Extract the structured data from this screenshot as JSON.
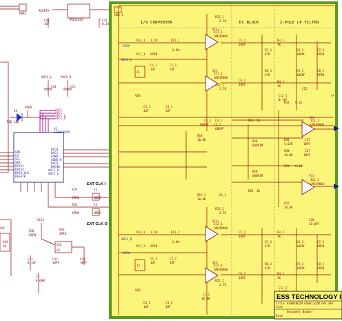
{
  "title_block": {
    "company": "ESS TECHNOLOGY I",
    "lines": [
      "Title",
      "ES9038Q2M ES9311Q2M DAC REF",
      "Size",
      "Document Number",
      "Date"
    ]
  },
  "sections": {
    "iv": "I/V CONVERTER",
    "dc": "DC BLOCK",
    "lpf": "2-POLE LP FILTER"
  },
  "clock_labels": {
    "ext_clk_1": "EXT CLK I",
    "ext_clk_2": "EXT CLK O"
  },
  "power_labels": {
    "avcc_l": "AVCC_L",
    "avcc_r": "AVCC_R",
    "avdd": "AVDD",
    "dvdd": "DVDD",
    "vcca": "VCCA",
    "vcc": "VCC",
    "reset": "RESET#"
  },
  "components": {
    "dac": "U1",
    "dac_part": "ES9038Q2M",
    "reg_top": "TM23LV33",
    "osc": "U2",
    "led": "D1",
    "led_part": "RED LED",
    "opamp_part": "LME49860",
    "opamps": [
      "IC1_1",
      "IC1_2",
      "IC2_1",
      "IC2_2",
      "IC3_1",
      "IC3_2",
      "IC4_1",
      "IC4_2",
      "IC5_1",
      "IC5_2"
    ],
    "resistors": [
      "R11",
      "R12",
      "R13",
      "R14",
      "R15",
      "R16",
      "R17",
      "R18",
      "R19",
      "R20",
      "R21",
      "R22",
      "R23",
      "R24",
      "R25",
      "R26"
    ],
    "capacitors": [
      "C1",
      "C2",
      "C3",
      "C4",
      "C5",
      "C6",
      "C7",
      "C8",
      "C9",
      "C10",
      "C11",
      "C12",
      "C13",
      "C14",
      "C15",
      "C16",
      "C17",
      "C40",
      "C41",
      "C42"
    ],
    "values": [
      "1.5K",
      "6.8K",
      "2.7K",
      "OPEN",
      "1UF",
      "10UF",
      "0.1UF",
      "100PF",
      "680PF",
      "10PF",
      "22PF",
      "33PF",
      "1K",
      "100R",
      "4.7K",
      "330R",
      "0 OHM"
    ],
    "headers": [
      "HDR2",
      "HDR3",
      "J1",
      "J2",
      "J3"
    ]
  },
  "dac_pins_left": [
    "GND",
    "CS",
    "SCL",
    "SDA",
    "DATA1",
    "DATA2",
    "DATA_CLK",
    "RESETB"
  ],
  "dac_pins_right": [
    "DACB",
    "DAC1",
    "AGND",
    "AGND_R",
    "DACR",
    "DACRB",
    "AVCC_R",
    "AVCC_L"
  ],
  "chart_data": {
    "type": "diagram",
    "blocks": [
      {
        "id": "dac",
        "label": "ES9038Q2M DAC"
      },
      {
        "id": "iv",
        "label": "I/V CONVERTER"
      },
      {
        "id": "dc",
        "label": "DC BLOCK"
      },
      {
        "id": "lpf",
        "label": "2-POLE LP FILTER"
      },
      {
        "id": "osc",
        "label": "EXT CLK"
      }
    ],
    "edges": [
      {
        "from": "dac",
        "to": "iv"
      },
      {
        "from": "iv",
        "to": "dc"
      },
      {
        "from": "dc",
        "to": "lpf"
      },
      {
        "from": "osc",
        "to": "dac"
      }
    ]
  },
  "colors": {
    "highlight_fill": "#fbf57a",
    "highlight_border": "#5c9a1c",
    "wire": "#8b0000",
    "bus": "#a0008c",
    "net": "#1c1c8a"
  }
}
